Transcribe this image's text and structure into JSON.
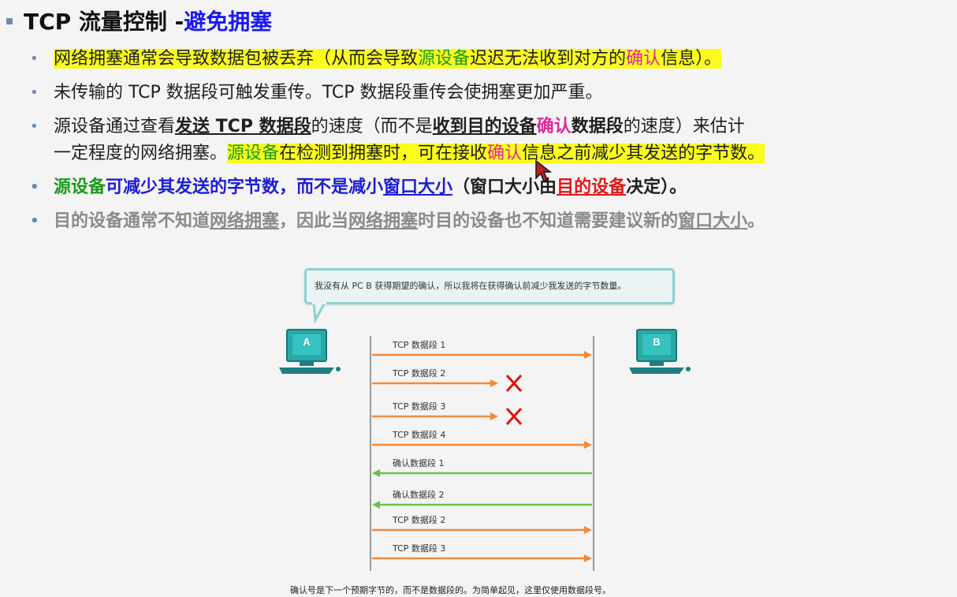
{
  "title": {
    "main": "TCP 流量控制 - ",
    "accent": "避免拥塞"
  },
  "bullets": {
    "b1": {
      "t1": "网络拥塞通常会导致数据包被丢弃（从而会导致",
      "t2": "源设备",
      "t3": "迟迟无法收到对方的",
      "t4": "确认",
      "t5": "信息）。"
    },
    "b2": {
      "t1": "未传输的 TCP 数据段可触发重传。TCP 数据段重传会使拥塞更加严重。"
    },
    "b3": {
      "t1": "源设备通过查看",
      "t2": "发送 TCP 数据段",
      "t3": "的速度（而不是",
      "t4": "收到目的设备",
      "t5": "确认",
      "t6": "数据段",
      "t7": "的速度）来估计",
      "t8": "一定程度的网络拥塞。",
      "t9": "源设备",
      "t10": "在检测到拥塞时，可在接收",
      "t11": "确认",
      "t12": "信息之前减少其发送的字节数。"
    },
    "b4": {
      "t1": "源设备",
      "t2": "可减少其发送的字节数，而不是减小",
      "t3": "窗口大小",
      "t4": "（窗口大小由",
      "t5": "目的设备",
      "t6": "决定）。"
    },
    "b5": {
      "t1": "目的设备通常不知道",
      "t2": "网络拥塞",
      "t3": "，因此当",
      "t4": "网络拥塞",
      "t5": "时目的设备也不知道需要建议新的",
      "t6": "窗口大小",
      "t7": "。"
    }
  },
  "diagram": {
    "callout": "我没有从 PC B 获得期望的确认，所以我将在获得确认前减少我发送的字节数量。",
    "pc_a": "A",
    "pc_b": "B",
    "segments": [
      {
        "label": "TCP 数据段 1",
        "dir": "right",
        "lost": false
      },
      {
        "label": "TCP 数据段 2",
        "dir": "right",
        "lost": true
      },
      {
        "label": "TCP 数据段 3",
        "dir": "right",
        "lost": true
      },
      {
        "label": "TCP 数据段 4",
        "dir": "right",
        "lost": false
      },
      {
        "label": "确认数据段 1",
        "dir": "left",
        "lost": false
      },
      {
        "label": "确认数据段 2",
        "dir": "left",
        "lost": false
      },
      {
        "label": "TCP 数据段 2",
        "dir": "right",
        "lost": false
      },
      {
        "label": "TCP 数据段 3",
        "dir": "right",
        "lost": false
      }
    ],
    "caption": "确认号是下一个预期字节的，而不是数据段的。为简单起见，这里仅使用数据段号。"
  },
  "colors": {
    "highlight": "#fbfb1e",
    "orange_arrow": "#f08a3a",
    "green_arrow": "#6cc04a",
    "lost_mark": "#e01010",
    "pc_teal": "#2aa8a8"
  }
}
